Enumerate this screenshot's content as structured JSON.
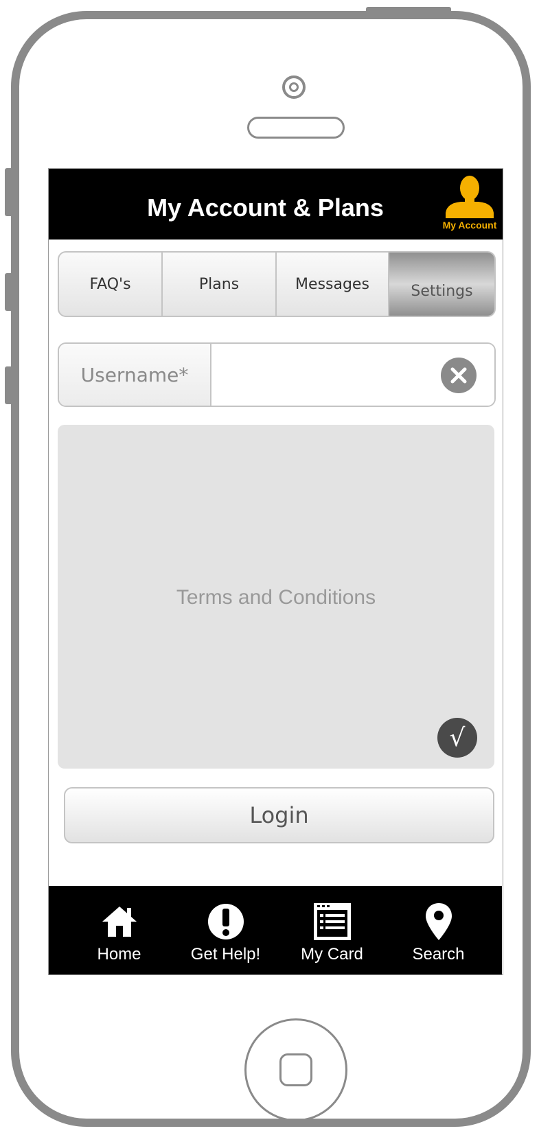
{
  "header": {
    "title": "My Account & Plans",
    "account_label": "My Account"
  },
  "tabs": [
    {
      "label": "FAQ's"
    },
    {
      "label": "Plans"
    },
    {
      "label": "Messages"
    },
    {
      "label": "Settings",
      "selected": true
    }
  ],
  "username": {
    "label": "Username*",
    "value": "",
    "placeholder": ""
  },
  "terms": {
    "label": "Terms and Conditions",
    "check_glyph": "√"
  },
  "login": {
    "label": "Login"
  },
  "bottom_nav": [
    {
      "label": "Home",
      "icon": "home-icon"
    },
    {
      "label": "Get Help!",
      "icon": "alert-icon"
    },
    {
      "label": "My Card",
      "icon": "card-icon"
    },
    {
      "label": "Search",
      "icon": "map-pin-icon"
    }
  ],
  "colors": {
    "header_bg": "#000000",
    "account_accent": "#f5b000",
    "terms_bg": "#e3e3e3",
    "frame": "#8a8a8a"
  }
}
